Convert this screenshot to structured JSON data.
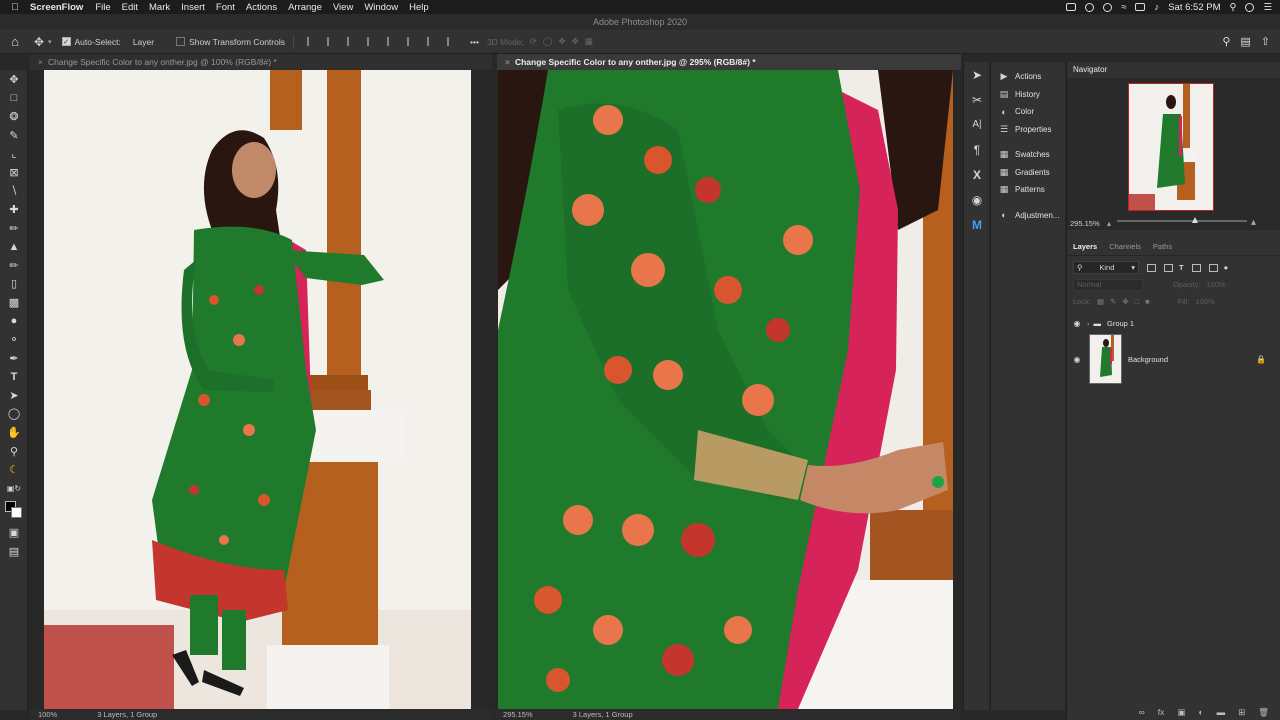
{
  "menubar": {
    "app": "ScreenFlow",
    "items": [
      "File",
      "Edit",
      "Mark",
      "Insert",
      "Font",
      "Actions",
      "Arrange",
      "View",
      "Window",
      "Help"
    ],
    "clock": "Sat 6:52 PM"
  },
  "window_title": "Adobe Photoshop 2020",
  "options": {
    "auto_select_label": "Auto-Select:",
    "auto_select_value": "Layer",
    "transform_label": "Show Transform Controls",
    "mode_3d": "3D Mode:"
  },
  "documents": [
    {
      "tab": "Change Specific Color to any onther.jpg @ 100% (RGB/8#) *",
      "zoom": "100%",
      "status": "3 Layers, 1 Group"
    },
    {
      "tab": "Change Specific Color to any onther.jpg @ 295% (RGB/8#) *",
      "zoom": "295.15%",
      "status": "3 Layers, 1 Group"
    }
  ],
  "panel_list": {
    "group1": [
      "Actions",
      "History",
      "Color",
      "Properties"
    ],
    "group2": [
      "Swatches",
      "Gradients",
      "Patterns"
    ],
    "group3": [
      "Adjustmen..."
    ]
  },
  "navigator": {
    "title": "Navigator",
    "zoom": "295.15%",
    "view_fraction": 0.6
  },
  "layers_panel": {
    "tabs": [
      "Layers",
      "Channels",
      "Paths"
    ],
    "filter_kind": "Kind",
    "blend_mode": "Normal",
    "opacity_label": "Opacity:",
    "opacity_value": "100%",
    "lock_label": "Lock:",
    "fill_label": "Fill:",
    "fill_value": "100%",
    "layers": [
      {
        "name": "Group 1",
        "type": "group"
      },
      {
        "name": "Background",
        "type": "image"
      }
    ]
  },
  "colors": {
    "accent_blue": "#3aa0ff",
    "dress_green": "#1f7a2c",
    "dupatta_pink": "#d6245a",
    "pillar_wood": "#b5601e"
  }
}
